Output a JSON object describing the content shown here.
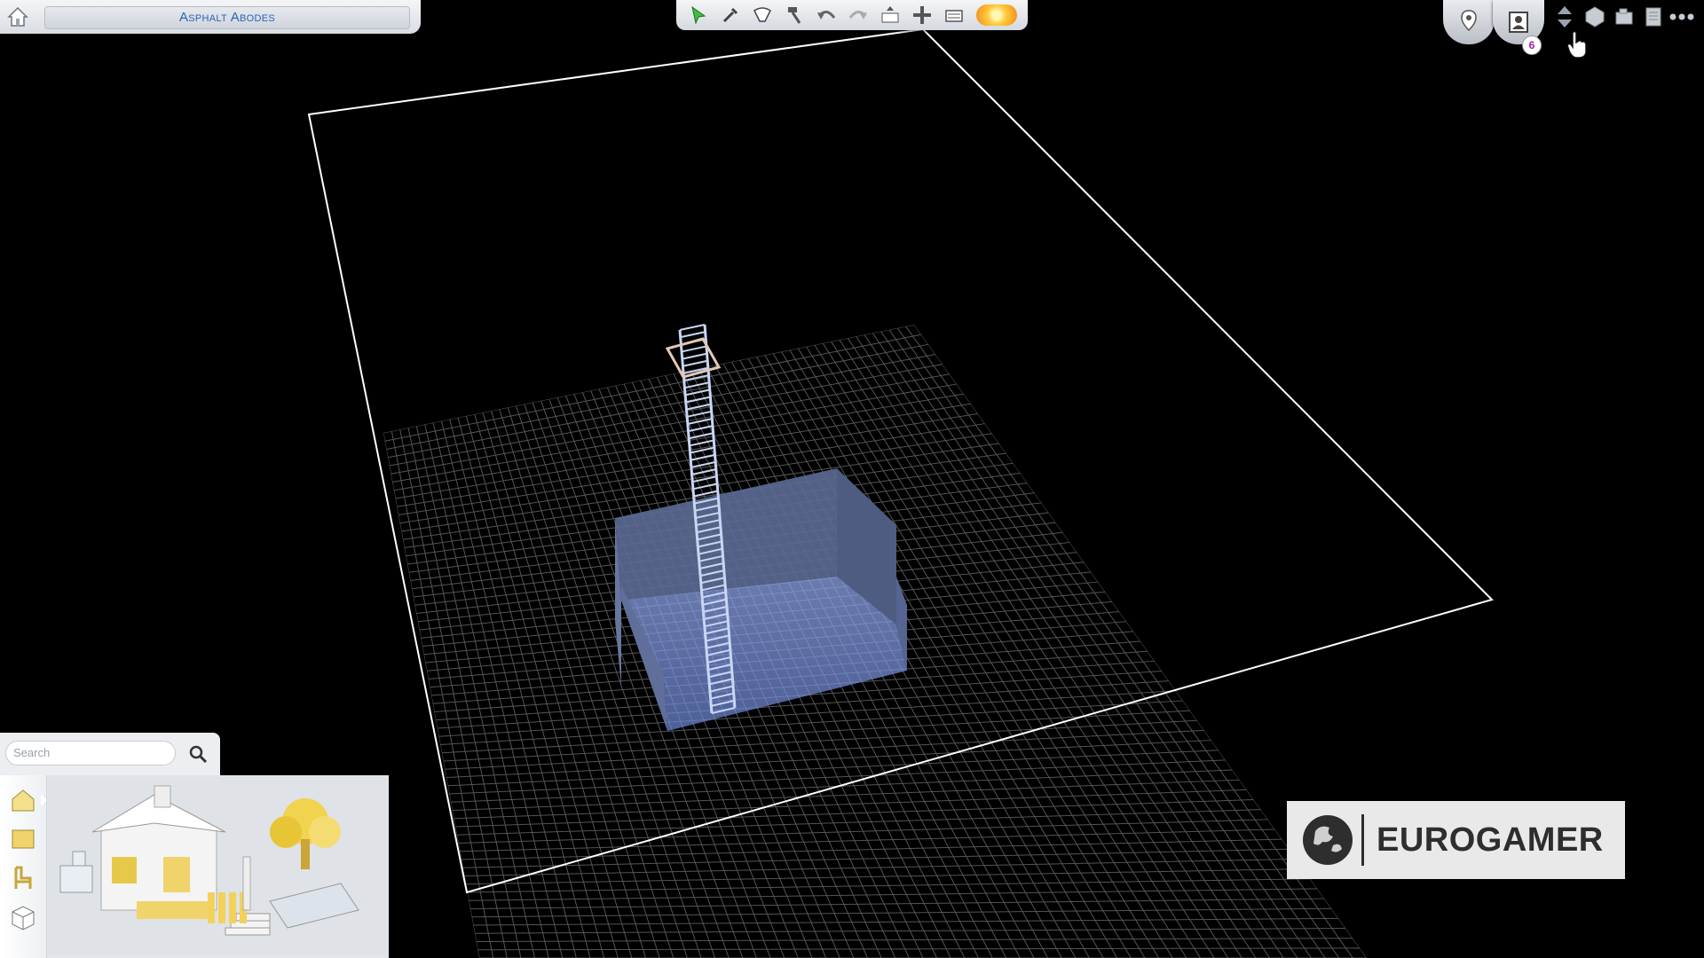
{
  "lot": {
    "name": "Asphalt Abodes"
  },
  "toolbar": {
    "tools": [
      {
        "icon": "select-arrow-icon"
      },
      {
        "icon": "eyedropper-icon"
      },
      {
        "icon": "design-tool-icon"
      },
      {
        "icon": "sledgehammer-icon"
      },
      {
        "icon": "undo-icon"
      },
      {
        "icon": "redo-icon"
      },
      {
        "icon": "move-rooms-icon"
      },
      {
        "icon": "move-lot-icon"
      },
      {
        "icon": "gallery-icon"
      },
      {
        "icon": "day-night-sun-icon"
      }
    ]
  },
  "top_right": {
    "household_count": "6",
    "buttons": [
      "map-pin-icon",
      "household-icon",
      "floor-up-down-icon",
      "wall-view-icon",
      "camera-icon",
      "options-menu-icon",
      "more-icon"
    ]
  },
  "catalog": {
    "search_placeholder": "Search",
    "tabs": [
      "build-house-icon",
      "rooms-icon",
      "furniture-chair-icon",
      "box-icon"
    ],
    "infinity_symbol": "∞"
  },
  "watermark": {
    "text": "EUROGAMER"
  },
  "colors": {
    "accent_text": "#2a64b8",
    "grid": "#3a3a3a",
    "room": "#7f95d6",
    "sun": "#ffbf3a"
  }
}
